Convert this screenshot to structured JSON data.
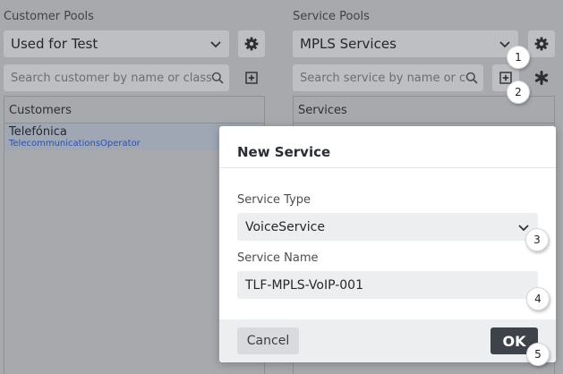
{
  "customer_pools": {
    "label": "Customer Pools",
    "selected": "Used for Test",
    "search_placeholder": "Search customer by name or class...",
    "panel_title": "Customers",
    "rows": [
      {
        "name": "Telefónica",
        "class": "TelecommunicationsOperator"
      }
    ]
  },
  "service_pools": {
    "label": "Service Pools",
    "selected": "MPLS Services",
    "search_placeholder": "Search service by name or class",
    "panel_title": "Services"
  },
  "modal": {
    "title": "New Service",
    "service_type_label": "Service Type",
    "service_type_value": "VoiceService",
    "service_name_label": "Service Name",
    "service_name_value": "TLF-MPLS-VoIP-001",
    "cancel_label": "Cancel",
    "ok_label": "OK"
  },
  "badges": [
    "1",
    "2",
    "3",
    "4",
    "5"
  ],
  "icons": {
    "settings": "gear-icon",
    "add": "plus-square-icon",
    "search": "search-icon",
    "dropdown": "chevron-down-icon",
    "special": "asterisk-icon"
  },
  "colors": {
    "ok_button": "#3e434a",
    "class_text": "#2d4fb0",
    "overlay": "#a7a9ad"
  }
}
